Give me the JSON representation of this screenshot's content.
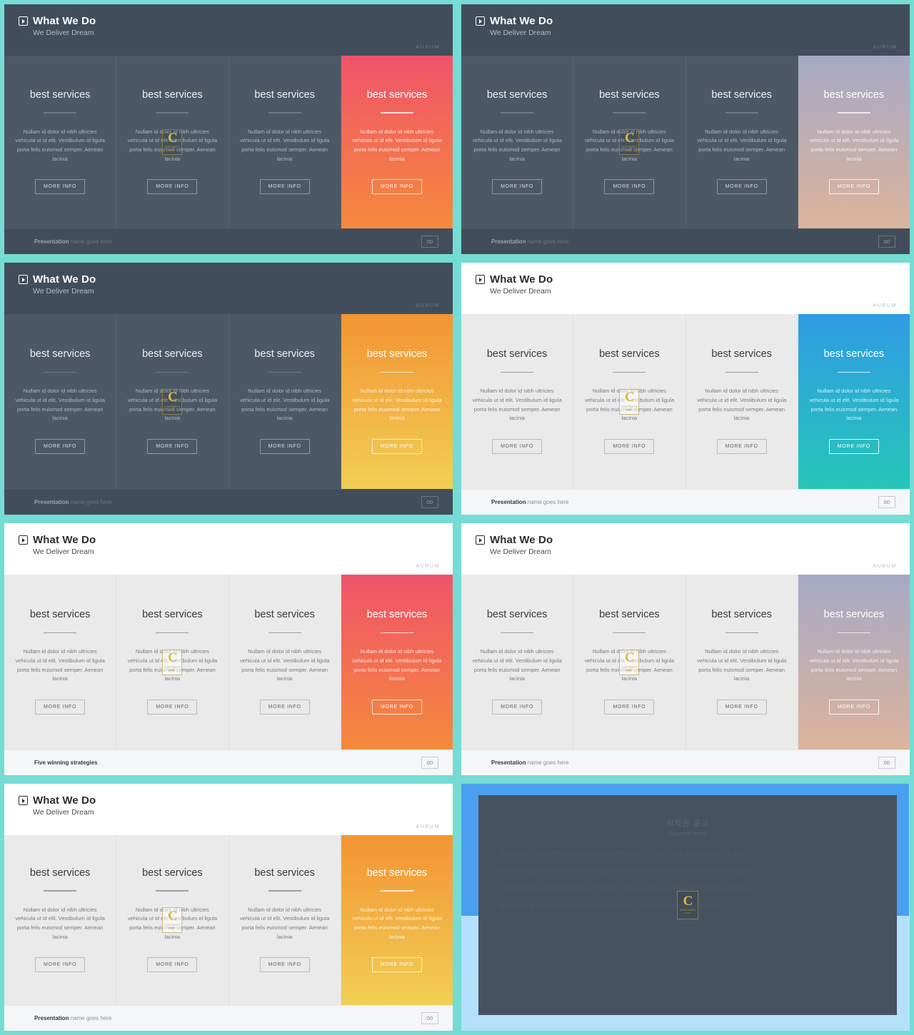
{
  "slide": {
    "title": "What We Do",
    "subtitle": "We Deliver Dream",
    "brand": "AURUM",
    "card_title": "best services",
    "card_desc": "Nullam id dolor id nibh ultricies vehicula ut id elit. Vestibulum id ligula porta felis euismod semper. Aenean lacinia",
    "button_label": "MORE INFO",
    "page_number": "00",
    "logo": {
      "letter": "C",
      "line1": "CONTENTS",
      "line2": "FAMILY"
    },
    "footer_strong": "Presentation",
    "footer_light": " name goes here",
    "footer_alt": "Five winning strategies"
  },
  "slides": [
    {
      "id": "slide-1",
      "theme": "dark",
      "accent_name": "pink-orange",
      "accent_from": "#f0536a",
      "accent_to": "#f58a3c",
      "footer_style": "default"
    },
    {
      "id": "slide-2",
      "theme": "dark",
      "accent_name": "muted-violet-peach",
      "accent_from": "#a6a9c6",
      "accent_to": "#dcb49c",
      "footer_style": "default"
    },
    {
      "id": "slide-3",
      "theme": "dark",
      "accent_name": "orange-yellow",
      "accent_from": "#f39433",
      "accent_to": "#f2cf55",
      "footer_style": "default"
    },
    {
      "id": "slide-4",
      "theme": "light",
      "accent_name": "blue-teal",
      "accent_from": "#2f9ce4",
      "accent_to": "#26c6b8",
      "footer_style": "default"
    },
    {
      "id": "slide-5",
      "theme": "light",
      "accent_name": "pink-orange",
      "accent_from": "#f0536a",
      "accent_to": "#f58a3c",
      "footer_style": "alt"
    },
    {
      "id": "slide-6",
      "theme": "light",
      "accent_name": "muted-violet-peach",
      "accent_from": "#a6a9c6",
      "accent_to": "#dcb49c",
      "footer_style": "default"
    },
    {
      "id": "slide-7",
      "theme": "light",
      "accent_name": "orange-yellow",
      "accent_from": "#f39433",
      "accent_to": "#f2cf55",
      "footer_style": "default"
    }
  ],
  "copyright": {
    "title": "저작권 공고",
    "subtitle": "Copyright Notice",
    "paragraphs": [
      "본 템플릿의 모든 저작권은 제작사에 있으며 무단 복제 및 재배포를 금합니다. 구매자는 개인 및 상업적 용도로 사용할 수 있습니다.",
      "본 저작물에 포함된 이미지, 아이콘, 서체 등의 구성 요소는 각 권리자의 라이선스 조건을 따르며 별도 추출하여 재판매할 수 없습니다.",
      "무단 전재 및 배포 시 관련 법령에 따라 민형사상의 책임을 질 수 있습니다. 자세한 내용은 구매처 이용약관을 참고하시기 바랍니다.",
      "템플릿 사용 중 문의사항이 있으시면 고객센터로 연락 주시기 바랍니다. 신속하게 답변해 드리겠습니다. 감사합니다.",
      "Copyright all rights reserved."
    ],
    "outer_color": "#b4e0fb",
    "band_color": "#4a9ff0",
    "panel_color": "#46525f"
  },
  "theme": {
    "page_background": "#74dcd4",
    "dark_header": "#414d5a",
    "dark_cards": "#4c5865",
    "light_cards": "#eaeaea"
  }
}
